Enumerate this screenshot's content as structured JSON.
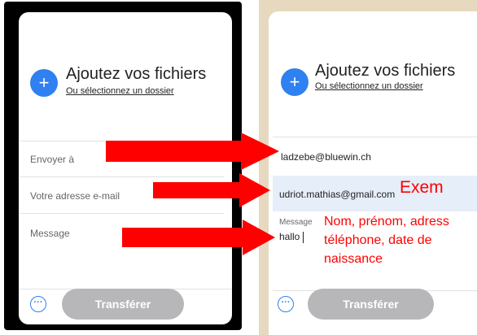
{
  "left_panel": {
    "add": {
      "plus": "+",
      "title": "Ajoutez vos fichiers",
      "subtitle": "Ou sélectionnez un dossier"
    },
    "fields": {
      "to": "Envoyer à",
      "email": "Votre adresse e-mail",
      "message": "Message"
    },
    "footer": {
      "more": "···",
      "transfer": "Transférer"
    }
  },
  "right_panel": {
    "add": {
      "plus": "+",
      "title": "Ajoutez vos fichiers",
      "subtitle": "Ou sélectionnez un dossier"
    },
    "fields": {
      "to_value": "ladzebe@bluewin.ch",
      "email_value": "udriot.mathias@gmail.com",
      "message_label": "Message",
      "message_value": "hallo"
    },
    "footer": {
      "more": "···",
      "transfer": "Transférer"
    }
  },
  "annotations": {
    "example": "Exem",
    "line1": "Nom, prénom, adress",
    "line2": "téléphone, date de",
    "line3": "naissance"
  },
  "colors": {
    "accent": "#2f80f1",
    "annotation": "#ff0000",
    "button_disabled": "#b7b7b9",
    "highlight": "#e6eef9"
  }
}
